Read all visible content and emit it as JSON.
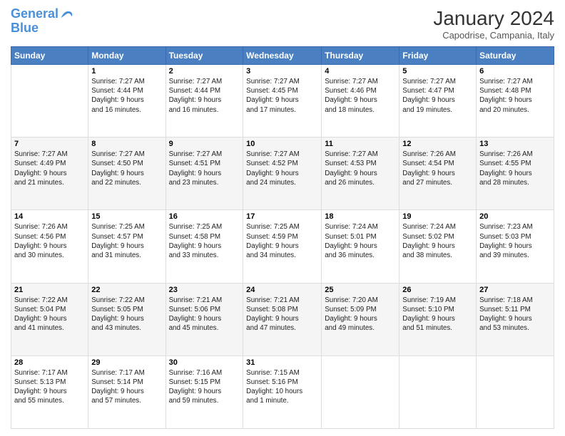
{
  "header": {
    "logo_line1": "General",
    "logo_line2": "Blue",
    "title": "January 2024",
    "subtitle": "Capodrise, Campania, Italy"
  },
  "columns": [
    "Sunday",
    "Monday",
    "Tuesday",
    "Wednesday",
    "Thursday",
    "Friday",
    "Saturday"
  ],
  "weeks": [
    [
      {
        "num": "",
        "info": ""
      },
      {
        "num": "1",
        "info": "Sunrise: 7:27 AM\nSunset: 4:44 PM\nDaylight: 9 hours\nand 16 minutes."
      },
      {
        "num": "2",
        "info": "Sunrise: 7:27 AM\nSunset: 4:44 PM\nDaylight: 9 hours\nand 16 minutes."
      },
      {
        "num": "3",
        "info": "Sunrise: 7:27 AM\nSunset: 4:45 PM\nDaylight: 9 hours\nand 17 minutes."
      },
      {
        "num": "4",
        "info": "Sunrise: 7:27 AM\nSunset: 4:46 PM\nDaylight: 9 hours\nand 18 minutes."
      },
      {
        "num": "5",
        "info": "Sunrise: 7:27 AM\nSunset: 4:47 PM\nDaylight: 9 hours\nand 19 minutes."
      },
      {
        "num": "6",
        "info": "Sunrise: 7:27 AM\nSunset: 4:48 PM\nDaylight: 9 hours\nand 20 minutes."
      }
    ],
    [
      {
        "num": "7",
        "info": "Sunrise: 7:27 AM\nSunset: 4:49 PM\nDaylight: 9 hours\nand 21 minutes."
      },
      {
        "num": "8",
        "info": "Sunrise: 7:27 AM\nSunset: 4:50 PM\nDaylight: 9 hours\nand 22 minutes."
      },
      {
        "num": "9",
        "info": "Sunrise: 7:27 AM\nSunset: 4:51 PM\nDaylight: 9 hours\nand 23 minutes."
      },
      {
        "num": "10",
        "info": "Sunrise: 7:27 AM\nSunset: 4:52 PM\nDaylight: 9 hours\nand 24 minutes."
      },
      {
        "num": "11",
        "info": "Sunrise: 7:27 AM\nSunset: 4:53 PM\nDaylight: 9 hours\nand 26 minutes."
      },
      {
        "num": "12",
        "info": "Sunrise: 7:26 AM\nSunset: 4:54 PM\nDaylight: 9 hours\nand 27 minutes."
      },
      {
        "num": "13",
        "info": "Sunrise: 7:26 AM\nSunset: 4:55 PM\nDaylight: 9 hours\nand 28 minutes."
      }
    ],
    [
      {
        "num": "14",
        "info": "Sunrise: 7:26 AM\nSunset: 4:56 PM\nDaylight: 9 hours\nand 30 minutes."
      },
      {
        "num": "15",
        "info": "Sunrise: 7:25 AM\nSunset: 4:57 PM\nDaylight: 9 hours\nand 31 minutes."
      },
      {
        "num": "16",
        "info": "Sunrise: 7:25 AM\nSunset: 4:58 PM\nDaylight: 9 hours\nand 33 minutes."
      },
      {
        "num": "17",
        "info": "Sunrise: 7:25 AM\nSunset: 4:59 PM\nDaylight: 9 hours\nand 34 minutes."
      },
      {
        "num": "18",
        "info": "Sunrise: 7:24 AM\nSunset: 5:01 PM\nDaylight: 9 hours\nand 36 minutes."
      },
      {
        "num": "19",
        "info": "Sunrise: 7:24 AM\nSunset: 5:02 PM\nDaylight: 9 hours\nand 38 minutes."
      },
      {
        "num": "20",
        "info": "Sunrise: 7:23 AM\nSunset: 5:03 PM\nDaylight: 9 hours\nand 39 minutes."
      }
    ],
    [
      {
        "num": "21",
        "info": "Sunrise: 7:22 AM\nSunset: 5:04 PM\nDaylight: 9 hours\nand 41 minutes."
      },
      {
        "num": "22",
        "info": "Sunrise: 7:22 AM\nSunset: 5:05 PM\nDaylight: 9 hours\nand 43 minutes."
      },
      {
        "num": "23",
        "info": "Sunrise: 7:21 AM\nSunset: 5:06 PM\nDaylight: 9 hours\nand 45 minutes."
      },
      {
        "num": "24",
        "info": "Sunrise: 7:21 AM\nSunset: 5:08 PM\nDaylight: 9 hours\nand 47 minutes."
      },
      {
        "num": "25",
        "info": "Sunrise: 7:20 AM\nSunset: 5:09 PM\nDaylight: 9 hours\nand 49 minutes."
      },
      {
        "num": "26",
        "info": "Sunrise: 7:19 AM\nSunset: 5:10 PM\nDaylight: 9 hours\nand 51 minutes."
      },
      {
        "num": "27",
        "info": "Sunrise: 7:18 AM\nSunset: 5:11 PM\nDaylight: 9 hours\nand 53 minutes."
      }
    ],
    [
      {
        "num": "28",
        "info": "Sunrise: 7:17 AM\nSunset: 5:13 PM\nDaylight: 9 hours\nand 55 minutes."
      },
      {
        "num": "29",
        "info": "Sunrise: 7:17 AM\nSunset: 5:14 PM\nDaylight: 9 hours\nand 57 minutes."
      },
      {
        "num": "30",
        "info": "Sunrise: 7:16 AM\nSunset: 5:15 PM\nDaylight: 9 hours\nand 59 minutes."
      },
      {
        "num": "31",
        "info": "Sunrise: 7:15 AM\nSunset: 5:16 PM\nDaylight: 10 hours\nand 1 minute."
      },
      {
        "num": "",
        "info": ""
      },
      {
        "num": "",
        "info": ""
      },
      {
        "num": "",
        "info": ""
      }
    ]
  ]
}
